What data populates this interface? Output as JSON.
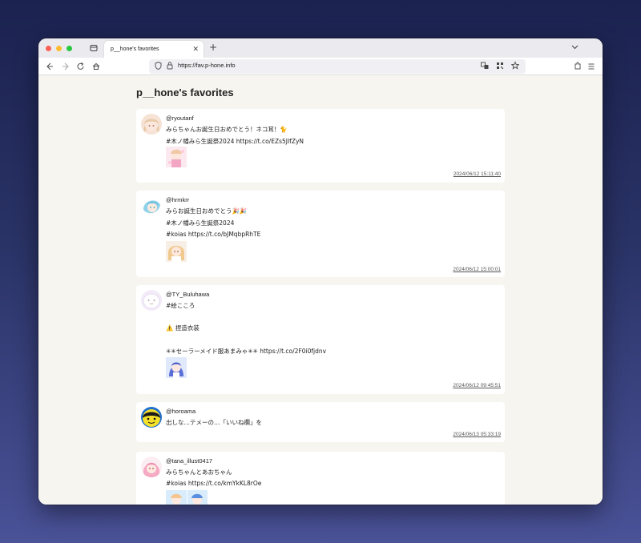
{
  "browser": {
    "tab_title": "p__hone's favorites",
    "url": "https://fav.p-hone.info"
  },
  "page": {
    "title": "p__hone's favorites"
  },
  "tweets": [
    {
      "user": "@ryoutanf",
      "lines": [
        "みらちゃんお誕生日おめでとう！ネコ耳！🐈",
        " #木ノ幡みら生誕祭2024 https://t.co/EZs5JIfZyN"
      ],
      "timestamp": "2024/06/12 15:11:40"
    },
    {
      "user": "@hrmkrr",
      "lines": [
        "みらお誕生日おめでとう🎉🎉",
        "#木ノ幡みら生誕祭2024",
        "#koias https://t.co/bJMqbpRhTE"
      ],
      "timestamp": "2024/06/12 15:00:01"
    },
    {
      "user": "@TY_Buluhawa",
      "lines": [
        "#絵こころ",
        "",
        "⚠️ 捏造衣装",
        "",
        "✳✳セーラーメイド服あまみゃ✳✳ https://t.co/2F0i0fjdnv"
      ],
      "timestamp": "2024/06/12 09:45:51"
    },
    {
      "user": "@horoama",
      "lines": [
        "出しな…テメーの…「いいね欄」を"
      ],
      "timestamp": "2024/06/13 05:33:19"
    },
    {
      "user": "@tana_illust0417",
      "lines": [
        "みらちゃんとあおちゃん",
        "#koias https://t.co/kmYkKL8rOe"
      ],
      "timestamp": ""
    }
  ]
}
